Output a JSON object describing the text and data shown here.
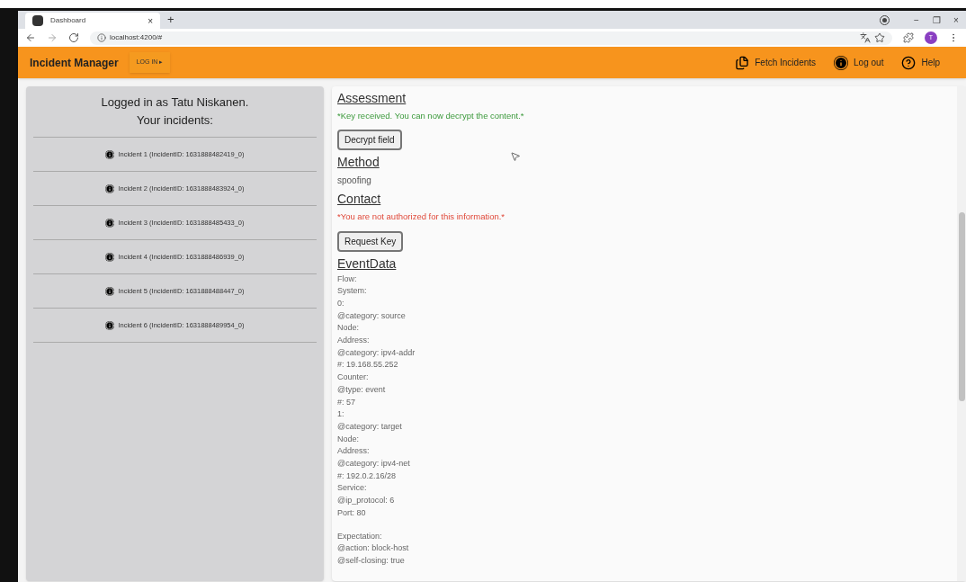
{
  "browser": {
    "tab_title": "Dashboard",
    "tab_close": "×",
    "new_tab": "+",
    "url": "localhost:4200/#",
    "window_controls": [
      "−",
      "❐",
      "×"
    ],
    "profile_initial": "T"
  },
  "app_bar": {
    "title": "Incident Manager",
    "login_button": "LOG IN ▸",
    "actions": [
      {
        "kind": "fetch",
        "label": "Fetch Incidents"
      },
      {
        "kind": "info",
        "label": "Log out"
      },
      {
        "kind": "help",
        "label": "Help"
      }
    ]
  },
  "sidebar": {
    "heading_lines": [
      "Logged in as Tatu Niskanen.",
      "Your incidents:"
    ],
    "incidents": [
      {
        "label": "Incident 1 (IncidentID: 1631888482419_0)"
      },
      {
        "label": "Incident 2 (IncidentID: 1631888483924_0)"
      },
      {
        "label": "Incident 3 (IncidentID: 1631888485433_0)"
      },
      {
        "label": "Incident 4 (IncidentID: 1631888486939_0)"
      },
      {
        "label": "Incident 5 (IncidentID: 1631888488447_0)"
      },
      {
        "label": "Incident 6 (IncidentID: 1631888489954_0)"
      }
    ]
  },
  "detail": {
    "sections": [
      {
        "title": "Assessment",
        "items": [
          {
            "kind": "success",
            "text": "*Key received. You can now decrypt the content.*"
          },
          {
            "kind": "button",
            "text": "Decrypt field"
          }
        ]
      },
      {
        "title": "Method",
        "items": [
          {
            "kind": "text",
            "text": "spoofing"
          }
        ]
      },
      {
        "title": "Contact",
        "items": [
          {
            "kind": "error",
            "text": "*You are not authorized for this information.*"
          },
          {
            "kind": "button",
            "text": "Request Key"
          }
        ]
      },
      {
        "title": "EventData",
        "items": [
          {
            "kind": "lines",
            "lines": [
              "Flow:",
              "System:",
              "0:",
              "@category: source",
              "Node:",
              "Address:",
              "@category: ipv4-addr",
              "#: 19.168.55.252",
              "Counter:",
              "@type: event",
              "#: 57",
              "1:",
              "@category: target",
              "Node:",
              "Address:",
              "@category: ipv4-net",
              "#: 192.0.2.16/28",
              "Service:",
              "@ip_protocol: 6",
              "Port: 80"
            ]
          },
          {
            "kind": "lines",
            "lines": [
              "Expectation:",
              "@action: block-host",
              "@self-closing: true"
            ]
          }
        ]
      }
    ]
  }
}
